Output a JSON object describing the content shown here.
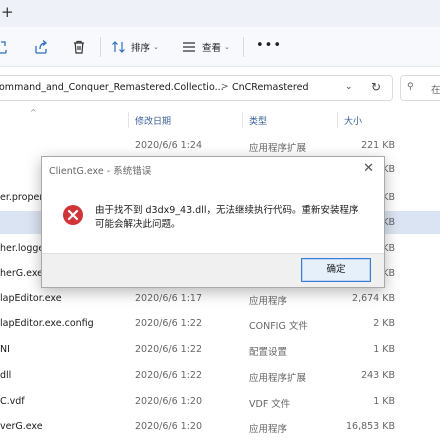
{
  "tabstrip": {
    "new_tab": "+"
  },
  "toolbar": {
    "sort_label": "排序",
    "view_label": "查看",
    "more_label": "•••",
    "icons": [
      "share-icon",
      "share-icon",
      "delete-icon",
      "sort-icon",
      "view-icon",
      "more-icon"
    ]
  },
  "address": {
    "crumb_folder": "ommand_and_Conquer_Remastered.Collectio...",
    "crumb_current": "CnCRemastered",
    "separator": ">",
    "search_placeholder": "在"
  },
  "columns": {
    "date": "修改日期",
    "type": "类型",
    "size": "大小"
  },
  "files": [
    {
      "name": "",
      "date": "2020/6/6 1:24",
      "type": "应用程序扩展",
      "size": "221 KB"
    },
    {
      "name": "",
      "date": "",
      "type": "",
      "size": "KB"
    },
    {
      "name": "er.proper",
      "date": "",
      "type": "",
      "size": "KB"
    },
    {
      "name": "",
      "date": "",
      "type": "",
      "size": "KB"
    },
    {
      "name": "her.logge",
      "date": "",
      "type": "",
      "size": "KB"
    },
    {
      "name": "herG.exe",
      "date": "",
      "type": "",
      "size": "KB"
    },
    {
      "name": "lapEditor.exe",
      "date": "2020/6/6 1:17",
      "type": "应用程序",
      "size": "2,674 KB"
    },
    {
      "name": "lapEditor.exe.config",
      "date": "2020/6/6 1:22",
      "type": "CONFIG 文件",
      "size": "2 KB"
    },
    {
      "name": "NI",
      "date": "2020/6/6 1:22",
      "type": "配置设置",
      "size": "1 KB"
    },
    {
      "name": "dll",
      "date": "2020/6/6 1:22",
      "type": "应用程序扩展",
      "size": "243 KB"
    },
    {
      "name": "C.vdf",
      "date": "2020/6/6 1:20",
      "type": "VDF 文件",
      "size": "1 KB"
    },
    {
      "name": "verG.exe",
      "date": "2020/6/6 1:20",
      "type": "应用程序",
      "size": "16,853 KB"
    }
  ],
  "dialog": {
    "title": "ClientG.exe - 系统错误",
    "message": "由于找不到 d3dx9_43.dll，无法继续执行代码。重新安装程序可能会解决此问题。",
    "ok_label": "确定",
    "close_glyph": "✕"
  },
  "colors": {
    "accent": "#3a7bd5",
    "error_red": "#d13438",
    "selected_row": "#dbe4f2"
  }
}
